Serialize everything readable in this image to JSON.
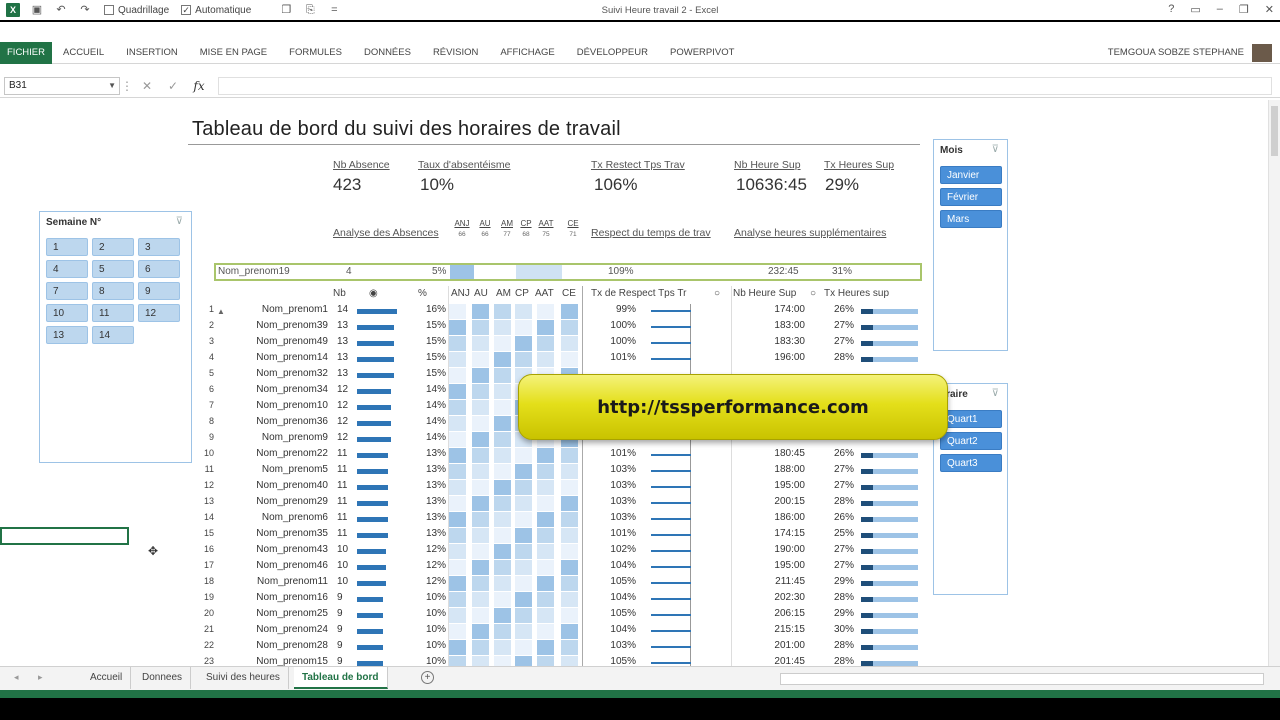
{
  "window": {
    "title": "Suivi Heure travail 2 - Excel"
  },
  "quick_access": {
    "gridlines_label": "Quadrillage",
    "auto_label": "Automatique"
  },
  "ribbon": {
    "file": "FICHIER",
    "tabs": [
      "ACCUEIL",
      "INSERTION",
      "MISE EN PAGE",
      "FORMULES",
      "DONNÉES",
      "RÉVISION",
      "AFFICHAGE",
      "DÉVELOPPEUR",
      "POWERPIVOT"
    ],
    "user": "TEMGOUA SOBZE STEPHANE"
  },
  "formula_bar": {
    "name_box": "B31",
    "fx": "fx",
    "value": ""
  },
  "dashboard": {
    "title": "Tableau de bord du suivi des horaires de travail",
    "kpis": {
      "nb_absence_label": "Nb Absence",
      "nb_absence_value": "423",
      "taux_label": "Taux d'absentéisme",
      "taux_value": "10%",
      "tx_restect_label": "Tx Restect Tps Trav",
      "tx_restect_value": "106%",
      "nb_heure_sup_label": "Nb Heure Sup",
      "nb_heure_sup_value": "10636:45",
      "tx_heures_sup_label": "Tx Heures Sup",
      "tx_heures_sup_value": "29%"
    },
    "absence_types": [
      {
        "code": "ANJ",
        "count": "66"
      },
      {
        "code": "AU",
        "count": "66"
      },
      {
        "code": "AM",
        "count": "77"
      },
      {
        "code": "CP",
        "count": "68"
      },
      {
        "code": "AAT",
        "count": "75"
      },
      {
        "code": "CE",
        "count": "71"
      }
    ],
    "sections": {
      "absences": "Analyse des Absences",
      "respect": "Respect du temps de trav",
      "heures_sup": "Analyse heures supplémentaires"
    },
    "highlight_row": {
      "name": "Nom_prenom19",
      "nb": "4",
      "pct": "5%",
      "tx": "109%",
      "hs": "232:45",
      "txh": "31%"
    },
    "table_headers": {
      "nb": "Nb",
      "pct": "%",
      "tx_respect": "Tx de Respect Tps Tr",
      "nb_heure_sup": "Nb Heure Sup",
      "tx_heures_sup": "Tx Heures sup"
    },
    "rows": [
      {
        "n": "1",
        "name": "Nom_prenom1",
        "nb": 14,
        "pct": "16%",
        "tx": "99%",
        "hs": "174:00",
        "txh": "26%"
      },
      {
        "n": "2",
        "name": "Nom_prenom39",
        "nb": 13,
        "pct": "15%",
        "tx": "100%",
        "hs": "183:00",
        "txh": "27%"
      },
      {
        "n": "3",
        "name": "Nom_prenom49",
        "nb": 13,
        "pct": "15%",
        "tx": "100%",
        "hs": "183:30",
        "txh": "27%"
      },
      {
        "n": "4",
        "name": "Nom_prenom14",
        "nb": 13,
        "pct": "15%",
        "tx": "101%",
        "hs": "196:00",
        "txh": "28%"
      },
      {
        "n": "5",
        "name": "Nom_prenom32",
        "nb": 13,
        "pct": "15%",
        "tx": "",
        "hs": "",
        "txh": ""
      },
      {
        "n": "6",
        "name": "Nom_prenom34",
        "nb": 12,
        "pct": "14%",
        "tx": "",
        "hs": "",
        "txh": ""
      },
      {
        "n": "7",
        "name": "Nom_prenom10",
        "nb": 12,
        "pct": "14%",
        "tx": "",
        "hs": "",
        "txh": ""
      },
      {
        "n": "8",
        "name": "Nom_prenom36",
        "nb": 12,
        "pct": "14%",
        "tx": "",
        "hs": "",
        "txh": ""
      },
      {
        "n": "9",
        "name": "Nom_prenom9",
        "nb": 12,
        "pct": "14%",
        "tx": "",
        "hs": "",
        "txh": ""
      },
      {
        "n": "10",
        "name": "Nom_prenom22",
        "nb": 11,
        "pct": "13%",
        "tx": "101%",
        "hs": "180:45",
        "txh": "26%"
      },
      {
        "n": "11",
        "name": "Nom_prenom5",
        "nb": 11,
        "pct": "13%",
        "tx": "103%",
        "hs": "188:00",
        "txh": "27%"
      },
      {
        "n": "12",
        "name": "Nom_prenom40",
        "nb": 11,
        "pct": "13%",
        "tx": "103%",
        "hs": "195:00",
        "txh": "27%"
      },
      {
        "n": "13",
        "name": "Nom_prenom29",
        "nb": 11,
        "pct": "13%",
        "tx": "103%",
        "hs": "200:15",
        "txh": "28%"
      },
      {
        "n": "14",
        "name": "Nom_prenom6",
        "nb": 11,
        "pct": "13%",
        "tx": "103%",
        "hs": "186:00",
        "txh": "26%"
      },
      {
        "n": "15",
        "name": "Nom_prenom35",
        "nb": 11,
        "pct": "13%",
        "tx": "101%",
        "hs": "174:15",
        "txh": "25%"
      },
      {
        "n": "16",
        "name": "Nom_prenom43",
        "nb": 10,
        "pct": "12%",
        "tx": "102%",
        "hs": "190:00",
        "txh": "27%"
      },
      {
        "n": "17",
        "name": "Nom_prenom46",
        "nb": 10,
        "pct": "12%",
        "tx": "104%",
        "hs": "195:00",
        "txh": "27%"
      },
      {
        "n": "18",
        "name": "Nom_prenom11",
        "nb": 10,
        "pct": "12%",
        "tx": "105%",
        "hs": "211:45",
        "txh": "29%"
      },
      {
        "n": "19",
        "name": "Nom_prenom16",
        "nb": 9,
        "pct": "10%",
        "tx": "104%",
        "hs": "202:30",
        "txh": "28%"
      },
      {
        "n": "20",
        "name": "Nom_prenom25",
        "nb": 9,
        "pct": "10%",
        "tx": "105%",
        "hs": "206:15",
        "txh": "29%"
      },
      {
        "n": "21",
        "name": "Nom_prenom24",
        "nb": 9,
        "pct": "10%",
        "tx": "104%",
        "hs": "215:15",
        "txh": "30%"
      },
      {
        "n": "22",
        "name": "Nom_prenom28",
        "nb": 9,
        "pct": "10%",
        "tx": "103%",
        "hs": "201:00",
        "txh": "28%"
      },
      {
        "n": "23",
        "name": "Nom_prenom15",
        "nb": 9,
        "pct": "10%",
        "tx": "105%",
        "hs": "201:45",
        "txh": "28%"
      },
      {
        "n": "24",
        "name": "Nom_prenom30",
        "nb": 9,
        "pct": "10%",
        "tx": "105%",
        "hs": "209:15",
        "txh": "29%"
      }
    ]
  },
  "slicer_semaine": {
    "title": "Semaine N°",
    "items": [
      "1",
      "2",
      "3",
      "4",
      "5",
      "6",
      "7",
      "8",
      "9",
      "10",
      "11",
      "12",
      "13",
      "14"
    ]
  },
  "slicer_mois": {
    "title": "Mois",
    "items": [
      "Janvier",
      "Février",
      "Mars"
    ]
  },
  "slicer_horaire": {
    "title": "oraire",
    "items": [
      "Quart1",
      "Quart2",
      "Quart3"
    ]
  },
  "banner": {
    "text": "http://tssperformance.com"
  },
  "sheet_tabs": [
    "Accueil",
    "Donnees",
    "Suivi des heures",
    "Tableau de bord"
  ],
  "active_sheet": "Tableau de bord",
  "colors": {
    "excel_green": "#217346",
    "bar_blue": "#2e75b6",
    "slicer_dark": "#4a90d9",
    "slicer_light": "#bdd7ee"
  }
}
